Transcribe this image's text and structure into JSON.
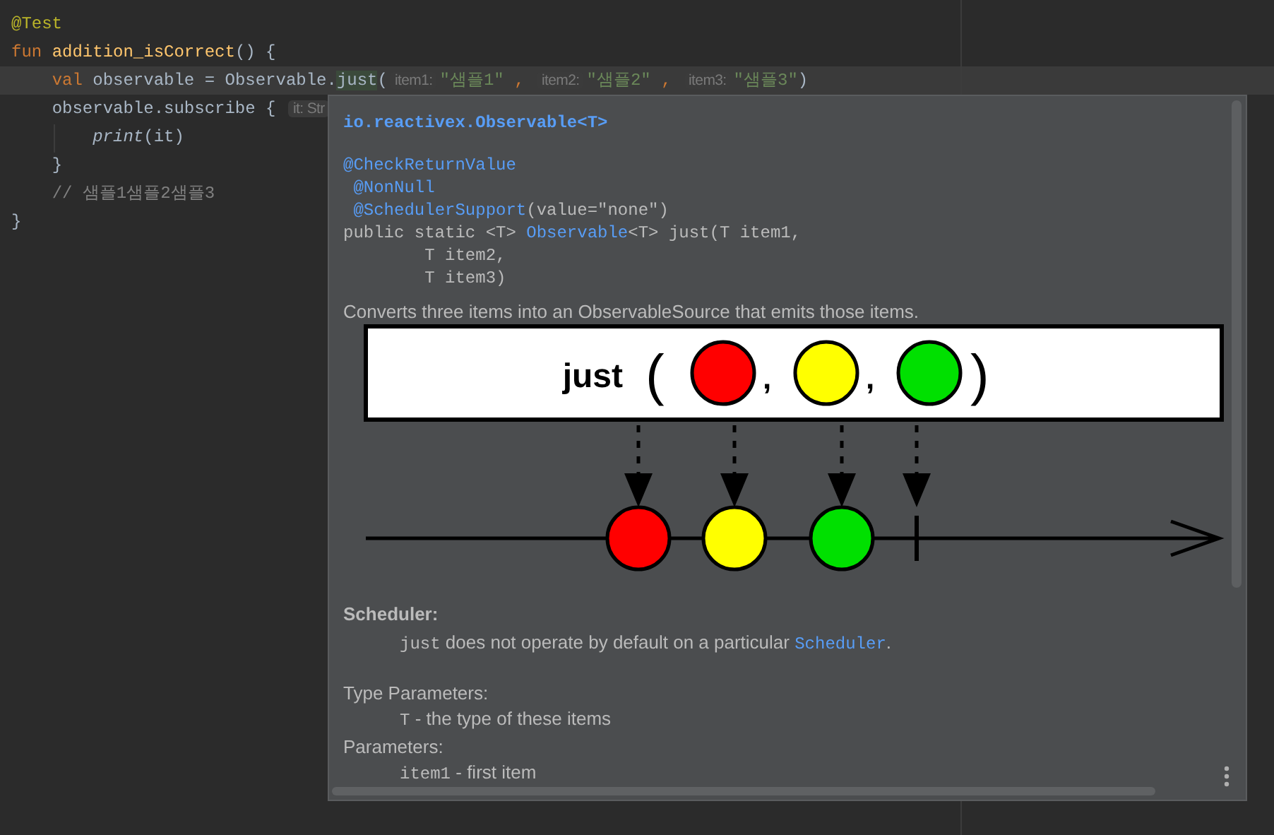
{
  "editor": {
    "lines": [
      {
        "current": false,
        "tokens": [
          {
            "kind": "annotation",
            "text": "@Test"
          }
        ]
      },
      {
        "current": false,
        "tokens": [
          {
            "kind": "keyword",
            "text": "fun "
          },
          {
            "kind": "function",
            "text": "addition_isCorrect"
          },
          {
            "kind": "plain",
            "text": "() {"
          }
        ]
      },
      {
        "current": true,
        "tokens": [
          {
            "kind": "keyword",
            "text": "    val"
          },
          {
            "kind": "plain",
            "text": " observable = Observable."
          },
          {
            "kind": "match",
            "text": "just"
          },
          {
            "kind": "plain",
            "text": "("
          },
          {
            "kind": "hint",
            "text": "item1:"
          },
          {
            "kind": "string",
            "text": "\"샘플1\""
          },
          {
            "kind": "keyword",
            "text": " , "
          },
          {
            "kind": "hint",
            "text": "item2:"
          },
          {
            "kind": "string",
            "text": "\"샘플2\""
          },
          {
            "kind": "keyword",
            "text": " , "
          },
          {
            "kind": "hint",
            "text": "item3:"
          },
          {
            "kind": "string",
            "text": "\"샘플3\""
          },
          {
            "kind": "plain",
            "text": ")"
          }
        ]
      },
      {
        "current": false,
        "tokens": [
          {
            "kind": "plain",
            "text": "    observable.subscribe { "
          },
          {
            "kind": "hint",
            "text": "it: Str"
          }
        ]
      },
      {
        "current": false,
        "tokens": [
          {
            "kind": "italic",
            "text": "        print"
          },
          {
            "kind": "plain",
            "text": "(it)"
          }
        ]
      },
      {
        "current": false,
        "tokens": [
          {
            "kind": "plain",
            "text": "    }"
          }
        ]
      },
      {
        "current": false,
        "tokens": [
          {
            "kind": "comment",
            "text": "    // 샘플1샘플2샘플3"
          }
        ]
      },
      {
        "current": false,
        "tokens": [
          {
            "kind": "plain",
            "text": "}"
          }
        ]
      }
    ]
  },
  "doc_popup": {
    "class_line": "io.reactivex.Observable<T>",
    "signature": [
      [
        {
          "kind": "link",
          "text": "@CheckReturnValue"
        }
      ],
      [
        {
          "kind": "link",
          "text": " @NonNull"
        }
      ],
      [
        {
          "kind": "link",
          "text": " @SchedulerSupport"
        },
        {
          "kind": "plain",
          "text": "(value=\"none\")"
        }
      ],
      [
        {
          "kind": "plain",
          "text": "public static <T> "
        },
        {
          "kind": "link",
          "text": "Observable"
        },
        {
          "kind": "plain",
          "text": "<T> just(T item1,"
        }
      ],
      [
        {
          "kind": "plain",
          "text": "        T item2,"
        }
      ],
      [
        {
          "kind": "plain",
          "text": "        T item3)"
        }
      ]
    ],
    "description": "Converts three items into an ObservableSource that emits those items.",
    "diagram": {
      "operator": "just",
      "open": "(",
      "separators": [
        ",",
        ","
      ],
      "close": ")",
      "marbles": [
        {
          "color": "#ff0000"
        },
        {
          "color": "#ffff00"
        },
        {
          "color": "#00e000"
        }
      ]
    },
    "scheduler": {
      "heading": "Scheduler:",
      "parts": [
        {
          "kind": "code",
          "text": "just"
        },
        {
          "kind": "text",
          "text": " does not operate by default on a particular "
        },
        {
          "kind": "link",
          "text": "Scheduler"
        },
        {
          "kind": "text",
          "text": "."
        }
      ]
    },
    "sections": [
      {
        "heading": "Type Parameters:",
        "items": [
          {
            "code": "T",
            "text": " - the type of these items"
          }
        ]
      },
      {
        "heading": "Parameters:",
        "items": [
          {
            "code": "item1",
            "text": " - first item"
          }
        ]
      }
    ]
  }
}
